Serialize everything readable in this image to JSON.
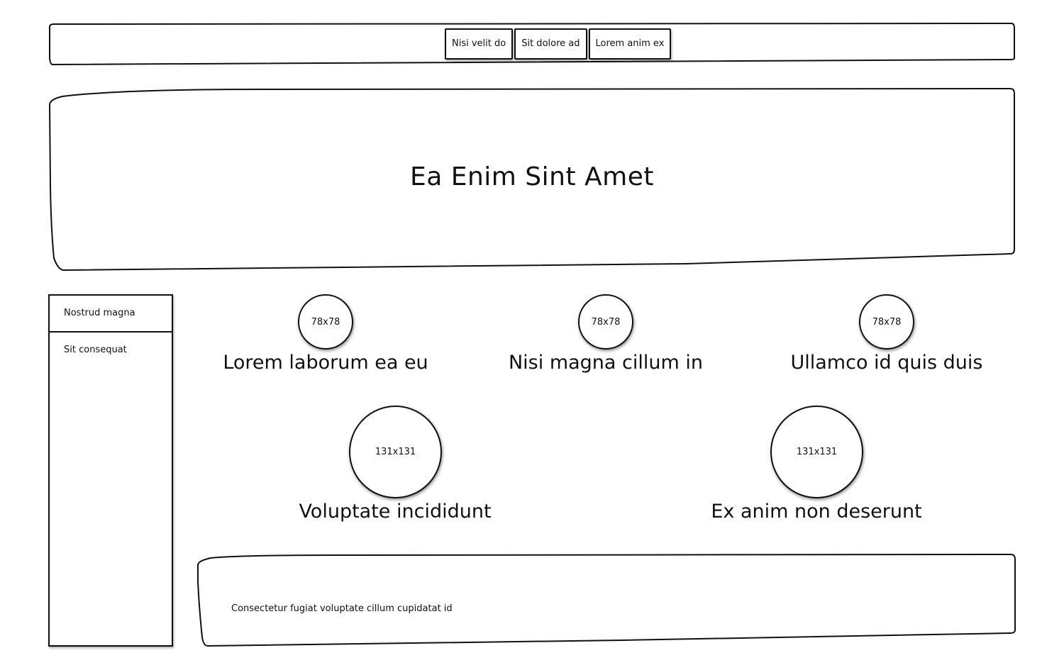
{
  "nav": {
    "buttons": [
      {
        "label": "Nisi velit do"
      },
      {
        "label": "Sit dolore ad"
      },
      {
        "label": "Lorem anim ex"
      }
    ]
  },
  "hero": {
    "title": "Ea Enim Sint Amet"
  },
  "sidebar": {
    "items": [
      {
        "label": "Nostrud magna"
      },
      {
        "label": "Sit consequat"
      }
    ]
  },
  "features": {
    "row1": [
      {
        "image_label": "78x78",
        "title": "Lorem laborum ea eu"
      },
      {
        "image_label": "78x78",
        "title": "Nisi magna cillum in"
      },
      {
        "image_label": "78x78",
        "title": "Ullamco id quis duis"
      }
    ],
    "row2": [
      {
        "image_label": "131x131",
        "title": "Voluptate incididunt"
      },
      {
        "image_label": "131x131",
        "title": "Ex anim non deserunt"
      }
    ]
  },
  "footer": {
    "text": "Consectetur fugiat voluptate cillum cupidatat id"
  }
}
